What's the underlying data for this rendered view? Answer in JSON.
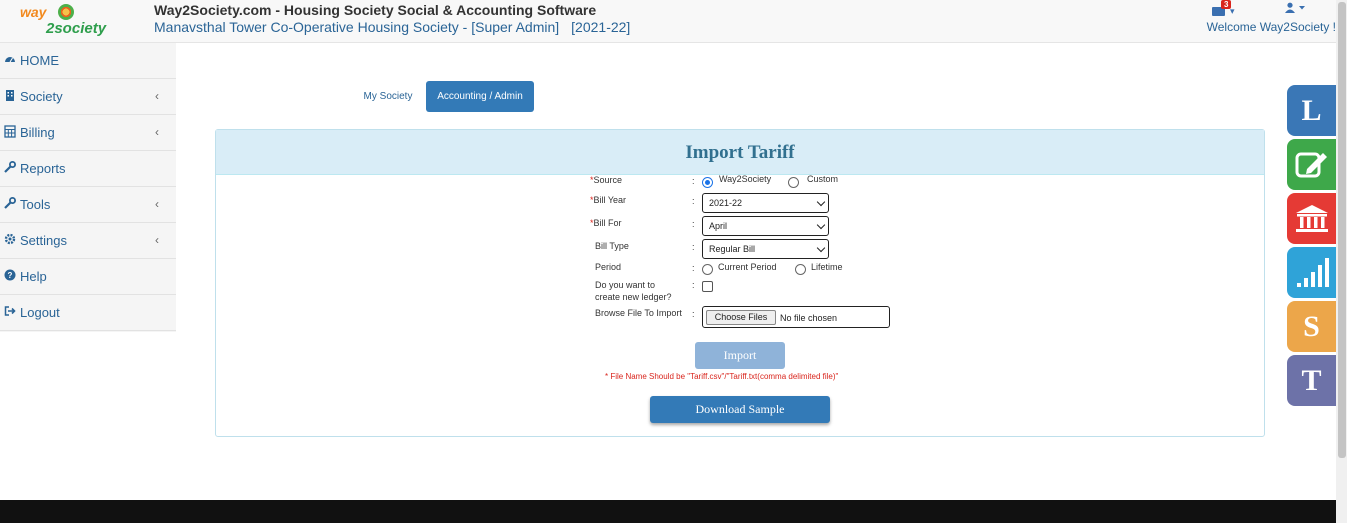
{
  "header": {
    "logo_word1": "way",
    "logo_word2": "society",
    "logo_digit": "2",
    "app_title": "Way2Society.com - Housing Society Social & Accounting Software",
    "society_name": "Manavsthal Tower Co-Operative Housing Society - [Super Admin]",
    "year": "[2021-22]",
    "mail_count": "3",
    "welcome": "Welcome Way2Society !"
  },
  "sidebar": {
    "items": [
      {
        "label": "HOME",
        "icon": "dashboard-icon"
      },
      {
        "label": "Society",
        "icon": "building-icon",
        "chevron": "‹"
      },
      {
        "label": "Billing",
        "icon": "calculator-icon",
        "chevron": "‹"
      },
      {
        "label": "Reports",
        "icon": "wrench-icon"
      },
      {
        "label": "Tools",
        "icon": "wrench-icon",
        "chevron": "‹"
      },
      {
        "label": "Settings",
        "icon": "gear-icon",
        "chevron": "‹"
      },
      {
        "label": "Help",
        "icon": "help-icon"
      },
      {
        "label": "Logout",
        "icon": "logout-icon"
      }
    ]
  },
  "tabs": {
    "my_society": "My Society",
    "accounting": "Accounting / Admin"
  },
  "form": {
    "title": "Import Tariff",
    "source_label": "Source",
    "source_opt1": "Way2Society",
    "source_opt2": "Custom",
    "source_selected": "Way2Society",
    "bill_year_label": "Bill Year",
    "bill_year_value": "2021-22",
    "bill_for_label": "Bill For",
    "bill_for_value": "April",
    "bill_type_label": "Bill Type",
    "bill_type_value": "Regular Bill",
    "period_label": "Period",
    "period_opt1": "Current Period",
    "period_opt2": "Lifetime",
    "ledger_label_line1": "Do you want to",
    "ledger_label_line2": "create new ledger?",
    "browse_label": "Browse File To Import",
    "choose_files": "Choose Files",
    "file_status": "No file chosen",
    "import_button": "Import",
    "note": "* File Name Should be \"Tariff.csv\"/\"Tariff.txt(comma delimited file)\"",
    "download_button": "Download Sample",
    "required_mark": "*",
    "colon": ":"
  },
  "side_tiles": [
    {
      "letter": "L",
      "color": "#3a77b6",
      "icon": "letter-l-icon"
    },
    {
      "letter": "",
      "color": "#3ea84a",
      "icon": "edit-icon"
    },
    {
      "letter": "",
      "color": "#e53a35",
      "icon": "bank-icon"
    },
    {
      "letter": "",
      "color": "#2fa3d8",
      "icon": "signal-bars-icon"
    },
    {
      "letter": "S",
      "color": "#eca64a",
      "icon": "letter-s-icon"
    },
    {
      "letter": "T",
      "color": "#6d72a8",
      "icon": "letter-t-icon"
    }
  ]
}
